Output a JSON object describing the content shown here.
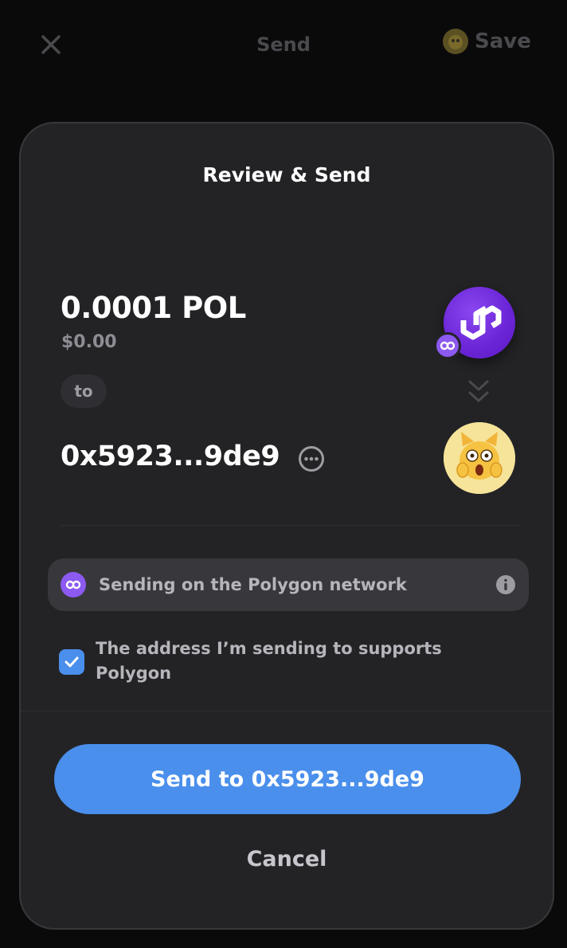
{
  "header": {
    "title": "Send",
    "save_label": "Save"
  },
  "sheet": {
    "title": "Review & Send",
    "amount": "0.0001 POL",
    "amount_usd": "$0.00",
    "to_label": "to",
    "recipient_address": "0x5923...9de9",
    "network_notice": "Sending on the Polygon network",
    "confirm_text": "The address I’m sending to supports Polygon",
    "confirm_checked": true,
    "send_button_label": "Send to 0x5923...9de9",
    "cancel_label": "Cancel"
  },
  "colors": {
    "accent": "#4a8fec",
    "polygon": "#8c5af0",
    "sheet_bg": "#232326"
  },
  "icons": {
    "close": "close-icon",
    "token": "polygon-token-icon",
    "network": "polygon-network-icon",
    "info": "info-icon",
    "more": "more-icon",
    "chevrons": "double-chevron-down-icon",
    "checkbox": "checkmark-icon"
  }
}
